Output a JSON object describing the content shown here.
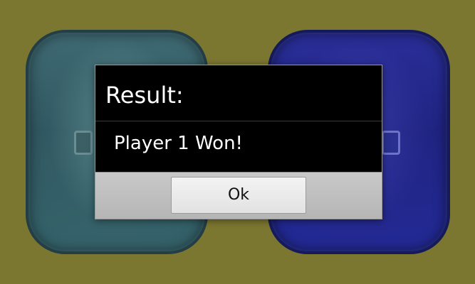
{
  "dialog": {
    "title": "Result:",
    "message": "Player 1 Won!",
    "ok_label": "Ok"
  },
  "background": {
    "left_pad_icon": "player-1-pad",
    "right_pad_icon": "player-2-pad"
  },
  "colors": {
    "page_background": "#7c7730",
    "left_pad": "#2f5660",
    "right_pad": "#1e2380",
    "dialog_background": "#000000",
    "dialog_footer": "#bdbdbd"
  }
}
